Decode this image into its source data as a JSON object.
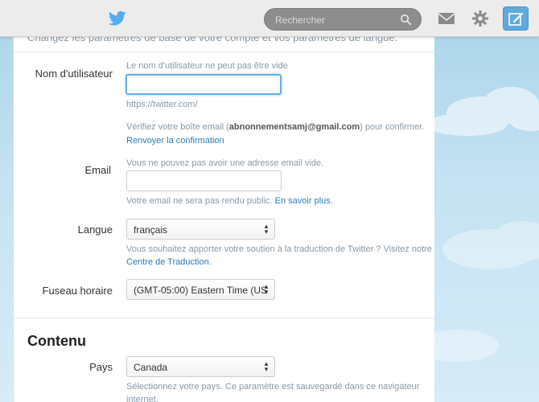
{
  "topbar": {
    "search_placeholder": "Rechercher",
    "accent": "#55acee"
  },
  "intro": "Changez les paramètres de base de votre compte et vos paramètres de langue.",
  "username": {
    "label": "Nom d'utilisateur",
    "error": "Le nom d'utilisateur ne peut pas être vide",
    "value": "",
    "url_hint": "https://twitter.com/",
    "verify_prefix": "Vérifiez votre boîte email (",
    "verify_email": "abnonnementsamj@gmail.com",
    "verify_suffix": ") pour confirmer.",
    "resend_link": "Renvoyer la confirmation"
  },
  "email": {
    "label": "Email",
    "error": "Vous ne pouvez pas avoir une adresse email vide.",
    "value": "",
    "note": "Votre email ne sera pas rendu public.",
    "learn_more": "En savoir plus."
  },
  "language": {
    "label": "Langue",
    "selected": "français",
    "help": "Vous souhaitez apporter votre soutien à la traduction de Twitter ? Visitez notre",
    "link": "Centre de Traduction."
  },
  "timezone": {
    "label": "Fuseau horaire",
    "selected": "(GMT-05:00) Eastern Time (US"
  },
  "content": {
    "title": "Contenu",
    "country_label": "Pays",
    "country_selected": "Canada",
    "country_help_1": "Sélectionnez votre pays. Ce paramètre est sauvegardé dans ce navigateur",
    "country_help_2": "internet."
  }
}
